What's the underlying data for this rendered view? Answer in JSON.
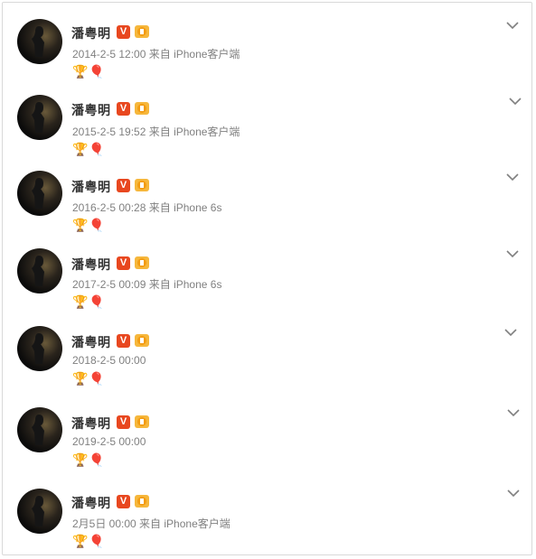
{
  "posts": [
    {
      "name": "潘粤明",
      "meta": "2014-2-5 12:00 来自 iPhone客户端",
      "emoji": "🏆🎈"
    },
    {
      "name": "潘粤明",
      "meta": "2015-2-5 19:52 来自 iPhone客户端",
      "emoji": "🏆🎈"
    },
    {
      "name": "潘粤明",
      "meta": "2016-2-5 00:28 来自 iPhone 6s",
      "emoji": "🏆🎈"
    },
    {
      "name": "潘粤明",
      "meta": "2017-2-5 00:09 来自 iPhone 6s",
      "emoji": "🏆🎈"
    },
    {
      "name": "潘粤明",
      "meta": "2018-2-5 00:00",
      "emoji": "🏆🎈"
    },
    {
      "name": "潘粤明",
      "meta": "2019-2-5 00:00",
      "emoji": "🏆🎈"
    },
    {
      "name": "潘粤明",
      "meta": "2月5日 00:00 来自 iPhone客户端",
      "emoji": "🏆🎈"
    }
  ],
  "verified_badge": "V",
  "colors": {
    "badge": "#e8471f",
    "meta_text": "#808080",
    "name_text": "#333333"
  },
  "icons": [
    "avatar",
    "verified-icon",
    "medal-icon",
    "chevron-down-icon"
  ]
}
